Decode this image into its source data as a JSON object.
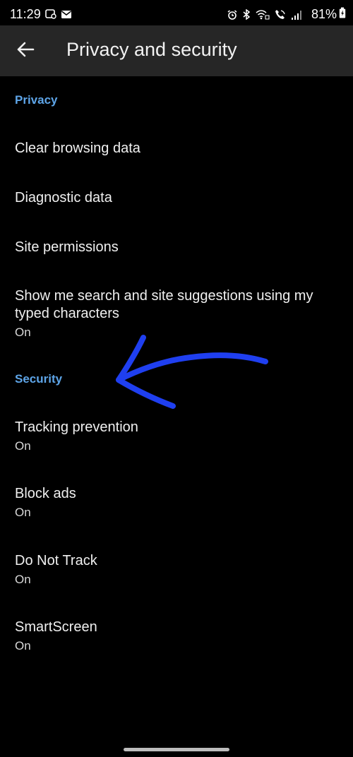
{
  "status_bar": {
    "time": "11:29",
    "battery_percent": "81%",
    "icons_left": [
      "screenshot-icon",
      "mail-icon"
    ],
    "icons_right": [
      "alarm-icon",
      "bluetooth-icon",
      "wifi-call-icon",
      "call-icon",
      "signal-icon"
    ]
  },
  "app_bar": {
    "back_icon": "back-arrow-icon",
    "title": "Privacy and security"
  },
  "privacy_section": {
    "header": "Privacy",
    "items": [
      {
        "title": "Clear browsing data"
      },
      {
        "title": "Diagnostic data"
      },
      {
        "title": "Site permissions"
      },
      {
        "title": "Show me search and site suggestions using my typed characters",
        "status": "On"
      }
    ]
  },
  "security_section": {
    "header": "Security",
    "items": [
      {
        "title": "Tracking prevention",
        "status": "On"
      },
      {
        "title": "Block ads",
        "status": "On"
      },
      {
        "title": "Do Not Track",
        "status": "On"
      },
      {
        "title": "SmartScreen",
        "status": "On"
      }
    ]
  },
  "annotation": {
    "type": "hand-drawn-arrow",
    "color": "#1f3ff0",
    "points_to": "Security"
  },
  "colors": {
    "background": "#000000",
    "app_bar": "#262626",
    "section_header": "#5ea5e8",
    "text": "#f0f0f0"
  }
}
